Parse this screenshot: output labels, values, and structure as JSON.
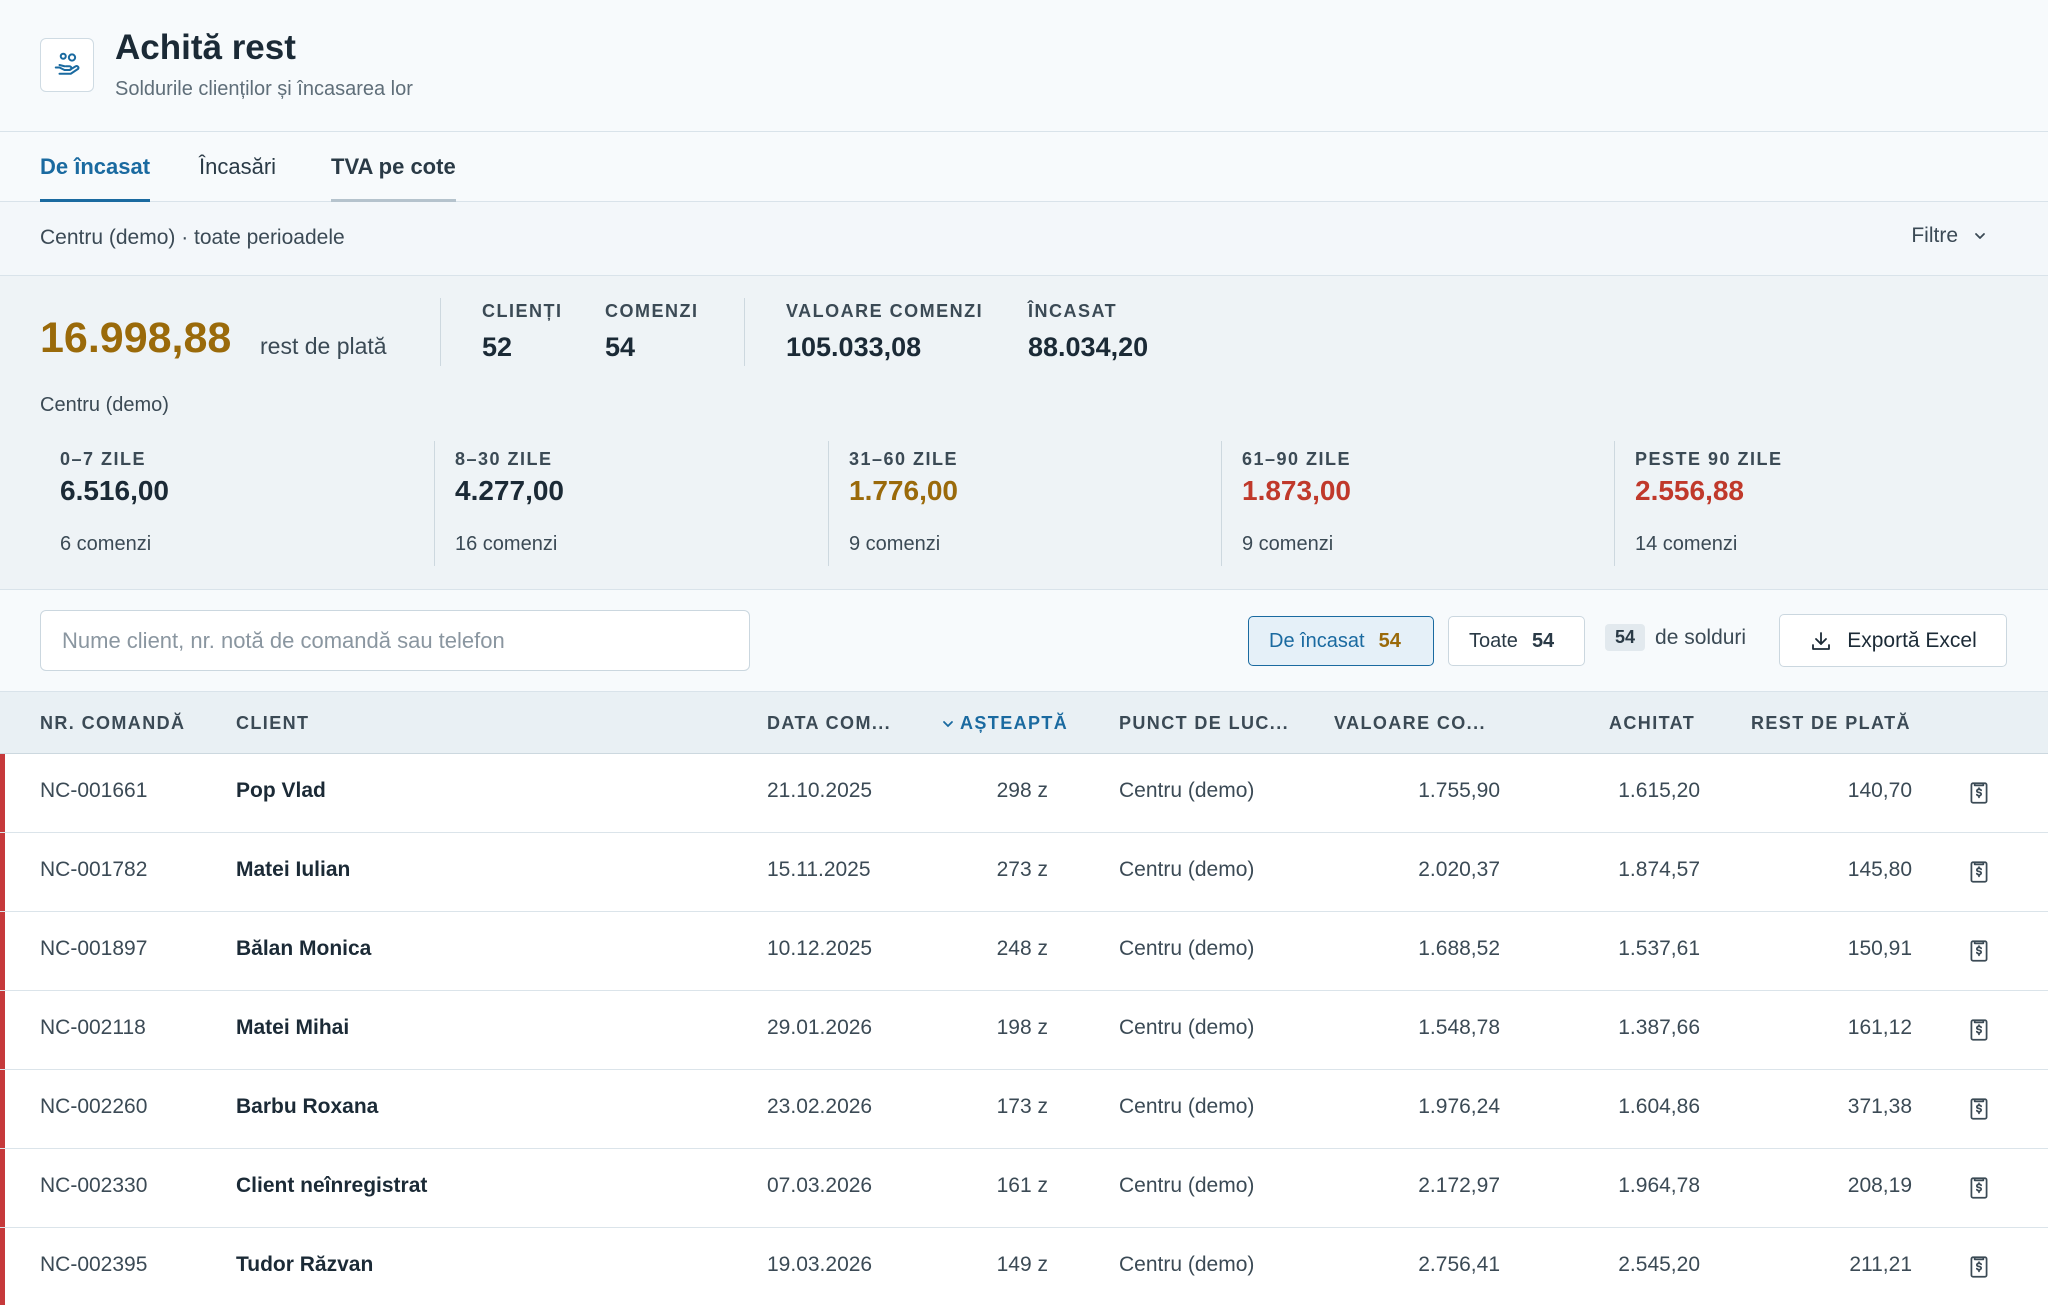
{
  "header": {
    "title": "Achită rest",
    "subtitle": "Soldurile clienților și încasarea lor",
    "icon": "hand-coins-icon"
  },
  "tabs": [
    {
      "label": "De încasat",
      "active": true
    },
    {
      "label": "Încasări",
      "active": false
    },
    {
      "label": "TVA pe cote",
      "active": false
    }
  ],
  "context": {
    "text": "Centru (demo) · toate perioadele",
    "filters_label": "Filtre"
  },
  "summary": {
    "total_amount": "16.998,88",
    "total_label": "rest de plată",
    "stats": [
      {
        "label": "CLIENȚI",
        "value": "52"
      },
      {
        "label": "COMENZI",
        "value": "54"
      },
      {
        "label": "VALOARE COMENZI",
        "value": "105.033,08"
      },
      {
        "label": "ÎNCASAT",
        "value": "88.034,20"
      }
    ],
    "location": "Centru (demo)",
    "buckets": [
      {
        "label": "0–7 ZILE",
        "value": "6.516,00",
        "count": "6 comenzi",
        "color": "#1b2a36"
      },
      {
        "label": "8–30 ZILE",
        "value": "4.277,00",
        "count": "16 comenzi",
        "color": "#1b2a36"
      },
      {
        "label": "31–60 ZILE",
        "value": "1.776,00",
        "count": "9 comenzi",
        "color": "#9a6a0a"
      },
      {
        "label": "61–90 ZILE",
        "value": "1.873,00",
        "count": "9 comenzi",
        "color": "#c0392b"
      },
      {
        "label": "PESTE 90 ZILE",
        "value": "2.556,88",
        "count": "14 comenzi",
        "color": "#c0392b"
      }
    ]
  },
  "toolbar": {
    "search_placeholder": "Nume client, nr. notă de comandă sau telefon",
    "chip_due_label": "De încasat",
    "chip_due_count": "54",
    "chip_all_label": "Toate",
    "chip_all_count": "54",
    "balances_count": "54",
    "balances_label": "de solduri",
    "export_label": "Exportă Excel"
  },
  "table": {
    "headers": {
      "order": "NR. COMANDĂ",
      "client": "CLIENT",
      "date": "DATA COM...",
      "waiting": "AȘTEAPTĂ",
      "location": "PUNCT DE LUC...",
      "value": "VALOARE CO...",
      "paid": "ACHITAT",
      "rest": "REST DE PLATĂ"
    },
    "rows": [
      {
        "order": "NC-001661",
        "client": "Pop Vlad",
        "date": "21.10.2025",
        "waiting": "298 z",
        "location": "Centru (demo)",
        "value": "1.755,90",
        "paid": "1.615,20",
        "rest": "140,70"
      },
      {
        "order": "NC-001782",
        "client": "Matei Iulian",
        "date": "15.11.2025",
        "waiting": "273 z",
        "location": "Centru (demo)",
        "value": "2.020,37",
        "paid": "1.874,57",
        "rest": "145,80"
      },
      {
        "order": "NC-001897",
        "client": "Bălan Monica",
        "date": "10.12.2025",
        "waiting": "248 z",
        "location": "Centru (demo)",
        "value": "1.688,52",
        "paid": "1.537,61",
        "rest": "150,91"
      },
      {
        "order": "NC-002118",
        "client": "Matei Mihai",
        "date": "29.01.2026",
        "waiting": "198 z",
        "location": "Centru (demo)",
        "value": "1.548,78",
        "paid": "1.387,66",
        "rest": "161,12"
      },
      {
        "order": "NC-002260",
        "client": "Barbu Roxana",
        "date": "23.02.2026",
        "waiting": "173 z",
        "location": "Centru (demo)",
        "value": "1.976,24",
        "paid": "1.604,86",
        "rest": "371,38"
      },
      {
        "order": "NC-002330",
        "client": "Client neînregistrat",
        "date": "07.03.2026",
        "waiting": "161 z",
        "location": "Centru (demo)",
        "value": "2.172,97",
        "paid": "1.964,78",
        "rest": "208,19"
      },
      {
        "order": "NC-002395",
        "client": "Tudor Răzvan",
        "date": "19.03.2026",
        "waiting": "149 z",
        "location": "Centru (demo)",
        "value": "2.756,41",
        "paid": "2.545,20",
        "rest": "211,21"
      }
    ]
  },
  "colors": {
    "accent": "#1a6aa0",
    "amount": "#9a6a0a",
    "danger": "#c0392b",
    "row_marker": "#c6393b"
  }
}
